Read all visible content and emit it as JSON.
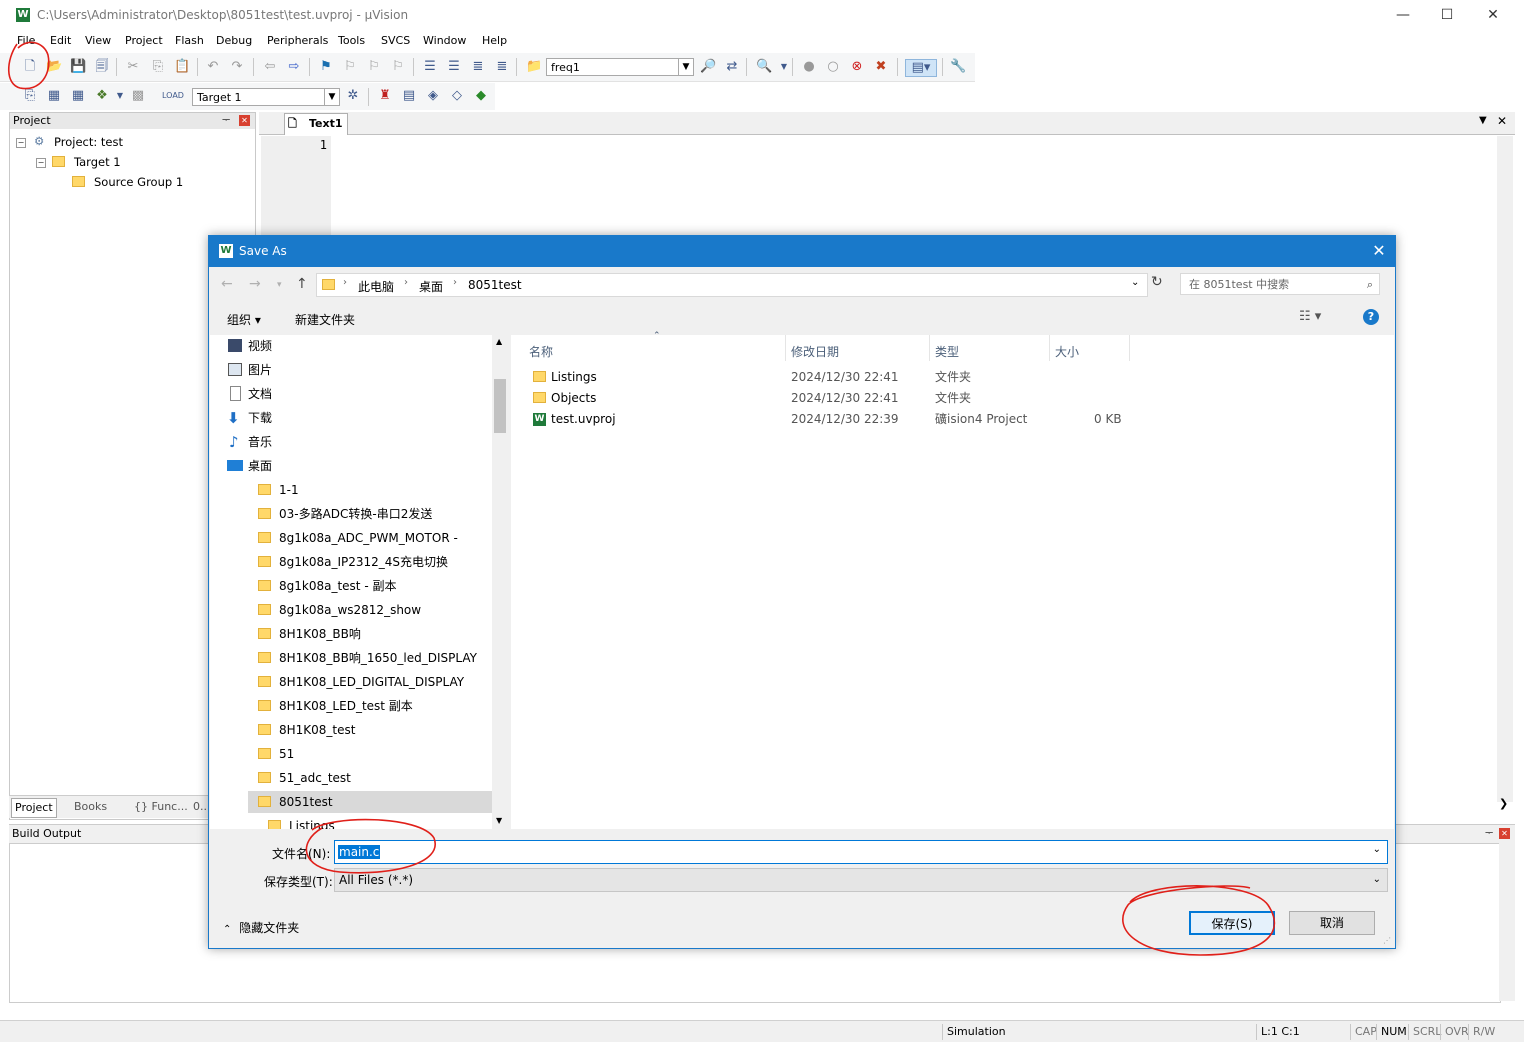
{
  "window": {
    "title": "C:\\Users\\Administrator\\Desktop\\8051test\\test.uvproj - µVision",
    "app_icon": "W",
    "minimize": "—",
    "maximize": "☐",
    "close": "✕"
  },
  "menu": [
    "File",
    "Edit",
    "View",
    "Project",
    "Flash",
    "Debug",
    "Peripherals",
    "Tools",
    "SVCS",
    "Window",
    "Help"
  ],
  "toolbar": {
    "find_combo_value": "freq1",
    "target_combo_value": "Target 1"
  },
  "project_panel": {
    "header": "Project",
    "pin": "ᅮ",
    "close": "✕",
    "tree": {
      "root": "Project: test",
      "target": "Target 1",
      "group": "Source Group 1"
    },
    "tabs": [
      "Project",
      "Books",
      "{} Func...",
      "0..."
    ]
  },
  "editor": {
    "tab_label": "Text1",
    "line_number": "1"
  },
  "build_output": {
    "header": "Build Output"
  },
  "status_bar": {
    "simulation": "Simulation",
    "position": "L:1 C:1",
    "cap": "CAP",
    "num": "NUM",
    "scrl": "SCRL",
    "ovr": "OVR",
    "rw": "R/W"
  },
  "dialog": {
    "title": "Save As",
    "breadcrumb": [
      "此电脑",
      "桌面",
      "8051test"
    ],
    "search_placeholder": "在 8051test 中搜索",
    "organize": "组织 ▾",
    "new_folder": "新建文件夹",
    "help": "?",
    "nav_items": [
      {
        "label": "视频",
        "icon": "video-icon"
      },
      {
        "label": "图片",
        "icon": "pictures-icon"
      },
      {
        "label": "文档",
        "icon": "documents-icon"
      },
      {
        "label": "下载",
        "icon": "download-icon"
      },
      {
        "label": "音乐",
        "icon": "music-icon"
      },
      {
        "label": "桌面",
        "icon": "desktop-icon"
      }
    ],
    "desktop_folders": [
      "1-1",
      "03-多路ADC转换-串口2发送",
      "8g1k08a_ADC_PWM_MOTOR -",
      "8g1k08a_IP2312_4S充电切换",
      "8g1k08a_test - 副本",
      "8g1k08a_ws2812_show",
      "8H1K08_BB响",
      "8H1K08_BB响_1650_led_DISPLAY",
      "8H1K08_LED_DIGITAL_DISPLAY",
      "8H1K08_LED_test 副本",
      "8H1K08_test",
      "51",
      "51_adc_test",
      "8051test",
      "Listings"
    ],
    "selected_folder": "8051test",
    "columns": [
      "名称",
      "修改日期",
      "类型",
      "大小"
    ],
    "files": [
      {
        "name": "Listings",
        "date": "2024/12/30 22:41",
        "type": "文件夹",
        "size": "",
        "kind": "folder"
      },
      {
        "name": "Objects",
        "date": "2024/12/30 22:41",
        "type": "文件夹",
        "size": "",
        "kind": "folder"
      },
      {
        "name": "test.uvproj",
        "date": "2024/12/30 22:39",
        "type": "礦ision4 Project",
        "size": "0 KB",
        "kind": "uvproj"
      }
    ],
    "filename_label": "文件名(N):",
    "filename_value": "main.c",
    "filetype_label": "保存类型(T):",
    "filetype_value": "All Files (*.*)",
    "hide_folders": "隐藏文件夹",
    "save_button": "保存(S)",
    "cancel_button": "取消"
  },
  "annotation_color": "#e0201a"
}
